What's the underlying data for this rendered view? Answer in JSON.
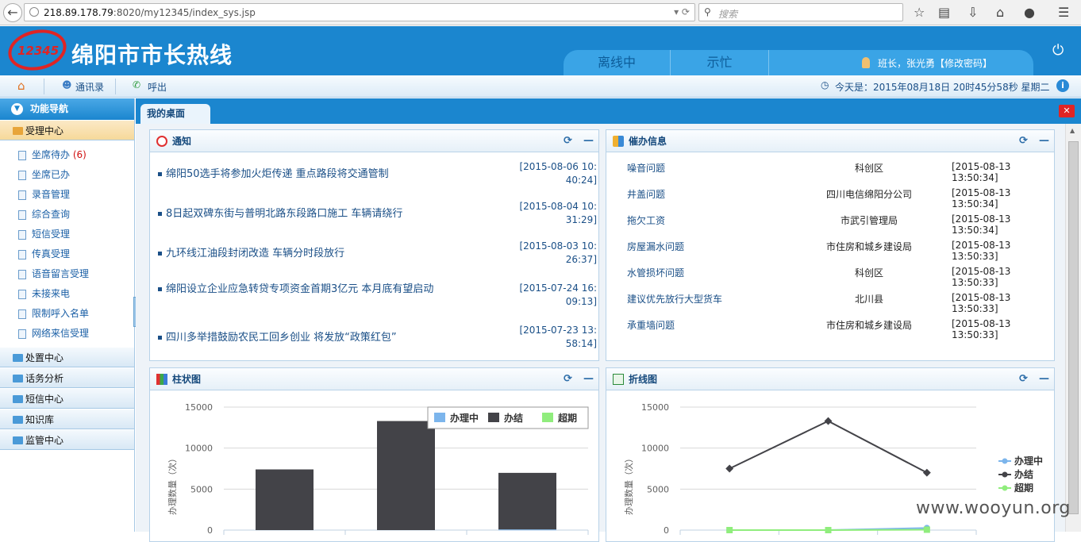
{
  "browser": {
    "url_host": "218.89.178.79",
    "url_rest": ":8020/my12345/index_sys.jsp",
    "search_placeholder": "搜索"
  },
  "header": {
    "logo_text": "12345",
    "title": "绵阳市市长热线",
    "status_tabs": [
      "离线中",
      "示忙"
    ],
    "user_text": "班长，张光勇【修改密码】"
  },
  "toolbar": {
    "contacts": "通讯录",
    "call": "呼出",
    "datetime": "今天是：2015年08月18日 20时45分58秒 星期二"
  },
  "sidebar": {
    "title": "功能导航",
    "active_group": "受理中心",
    "items": [
      {
        "label": "坐席待办",
        "count": "(6)"
      },
      {
        "label": "坐席已办"
      },
      {
        "label": "录音管理"
      },
      {
        "label": "综合查询"
      },
      {
        "label": "短信受理"
      },
      {
        "label": "传真受理"
      },
      {
        "label": "语音留言受理"
      },
      {
        "label": "未接来电"
      },
      {
        "label": "限制呼入名单"
      },
      {
        "label": "网络来信受理"
      }
    ],
    "groups": [
      "处置中心",
      "话务分析",
      "短信中心",
      "知识库",
      "监管中心"
    ]
  },
  "tabs": {
    "desktop": "我的桌面"
  },
  "notices": {
    "title": "通知",
    "items": [
      {
        "text": "绵阳50选手将参加火炬传递 重点路段将交通管制",
        "date": "[2015-08-06 10:40:24]"
      },
      {
        "text": "8日起双碑东街与普明北路东段路口施工 车辆请绕行",
        "date": "[2015-08-04 10:31:29]"
      },
      {
        "text": "九环线江油段封闭改造 车辆分时段放行",
        "date": "[2015-08-03 10:26:37]"
      },
      {
        "text": "绵阳设立企业应急转贷专项资金首期3亿元 本月底有望启动",
        "date": "[2015-07-24 16:09:13]"
      },
      {
        "text": "四川多举措鼓励农民工回乡创业 将发放“政策红包”",
        "date": "[2015-07-23 13:58:14]"
      }
    ]
  },
  "urge": {
    "title": "催办信息",
    "items": [
      {
        "topic": "噪音问题",
        "dept": "科创区",
        "time": "[2015-08-13 13:50:34]"
      },
      {
        "topic": "井盖问题",
        "dept": "四川电信绵阳分公司",
        "time": "[2015-08-13 13:50:34]"
      },
      {
        "topic": "拖欠工资",
        "dept": "市武引管理局",
        "time": "[2015-08-13 13:50:34]"
      },
      {
        "topic": "房屋漏水问题",
        "dept": "市住房和城乡建设局",
        "time": "[2015-08-13 13:50:33]"
      },
      {
        "topic": "水管损坏问题",
        "dept": "科创区",
        "time": "[2015-08-13 13:50:33]"
      },
      {
        "topic": "建议优先放行大型货车",
        "dept": "北川县",
        "time": "[2015-08-13 13:50:33]"
      },
      {
        "topic": "承重墙问题",
        "dept": "市住房和城乡建设局",
        "time": "[2015-08-13 13:50:33]"
      }
    ]
  },
  "bar_panel": {
    "title": "柱状图"
  },
  "line_panel": {
    "title": "折线图"
  },
  "chart_data": [
    {
      "type": "bar",
      "ylabel": "办理数量（次）",
      "ylim": [
        0,
        15000
      ],
      "yticks": [
        "15000",
        "10000",
        "5000",
        "0"
      ],
      "legend_position": "top-right",
      "series": [
        {
          "name": "办理中",
          "color": "#7cb5ec",
          "values": [
            0,
            0,
            80
          ]
        },
        {
          "name": "办结",
          "color": "#434348",
          "values": [
            7400,
            13300,
            6900
          ]
        },
        {
          "name": "超期",
          "color": "#90ed7d",
          "values": [
            0,
            0,
            0
          ]
        }
      ]
    },
    {
      "type": "line",
      "ylabel": "办理数量（次）",
      "ylim": [
        0,
        15000
      ],
      "yticks": [
        "15000",
        "10000",
        "5000",
        "0"
      ],
      "legend_position": "right",
      "series": [
        {
          "name": "办理中",
          "color": "#7cb5ec",
          "values": [
            0,
            0,
            250
          ]
        },
        {
          "name": "办结",
          "color": "#434348",
          "values": [
            7500,
            13300,
            7000
          ]
        },
        {
          "name": "超期",
          "color": "#90ed7d",
          "values": [
            0,
            0,
            50
          ]
        }
      ]
    }
  ],
  "watermark": "www.wooyun.org"
}
